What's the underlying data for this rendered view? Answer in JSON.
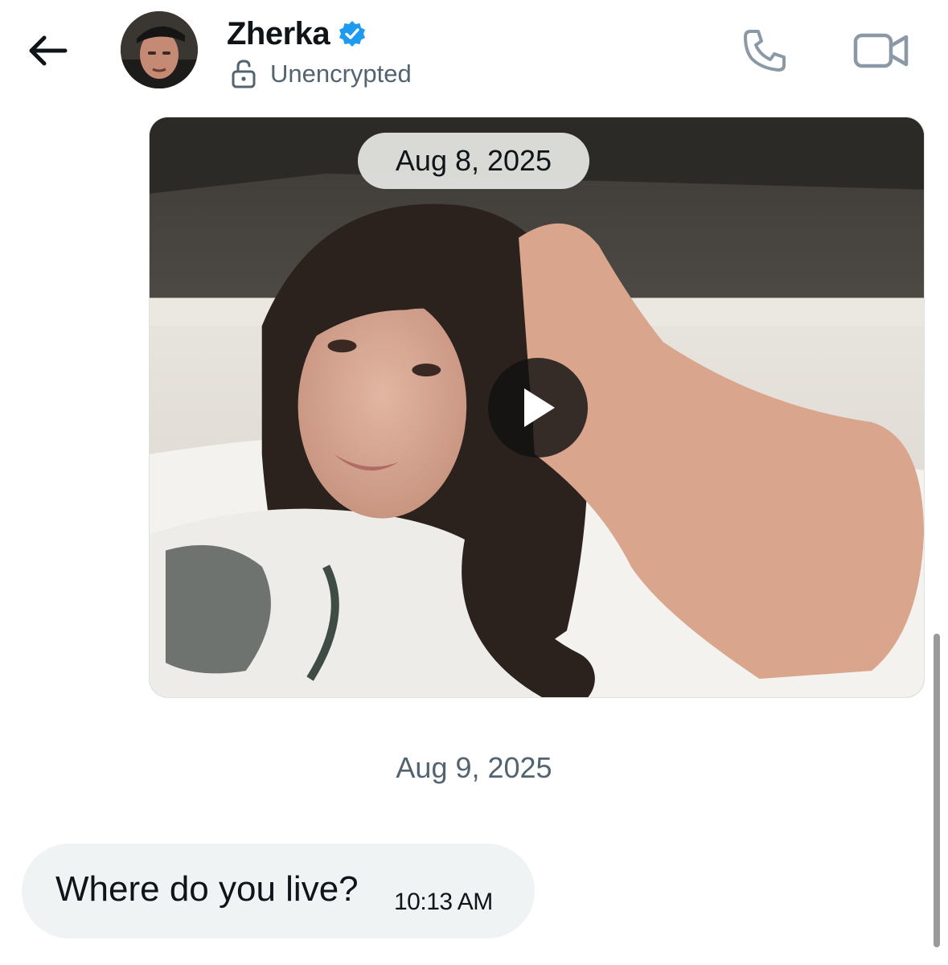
{
  "header": {
    "back_icon": "back-arrow-icon",
    "contact_name": "Zherka",
    "verified_icon": "verified-badge-icon",
    "verified_color": "#1d9bf0",
    "encryption_icon": "unlocked-padlock-icon",
    "encryption_status": "Unencrypted",
    "call_icon": "phone-icon",
    "video_call_icon": "video-camera-icon"
  },
  "conversation": {
    "video_message": {
      "date_label": "Aug 8, 2025",
      "play_icon": "play-icon"
    },
    "date_separator": "Aug 9, 2025",
    "messages": [
      {
        "direction": "incoming",
        "text": "Where do you live?",
        "time": "10:13 AM"
      }
    ]
  },
  "colors": {
    "secondary_text": "#536471",
    "bubble_background": "#eff3f4",
    "primary_text": "#0f1419"
  }
}
